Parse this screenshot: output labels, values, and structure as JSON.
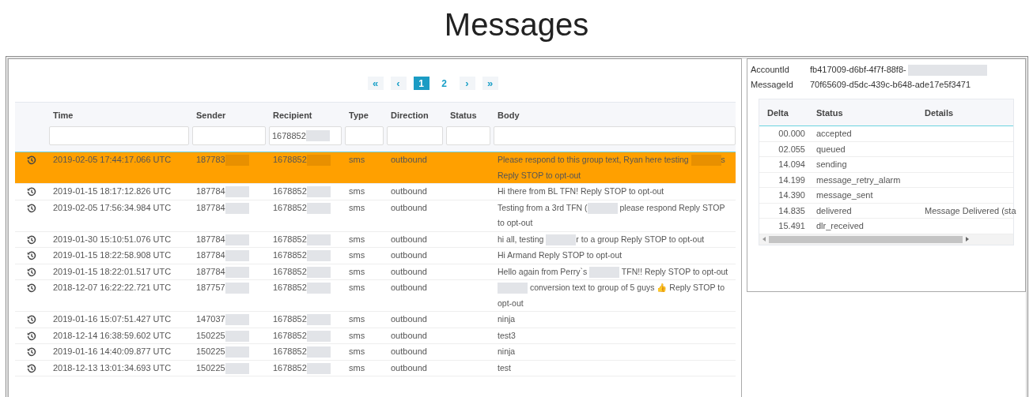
{
  "title": "Messages",
  "pagination": [
    {
      "label": "«",
      "kind": "first",
      "selected": false
    },
    {
      "label": "‹",
      "kind": "prev",
      "selected": false
    },
    {
      "label": "1",
      "kind": "page",
      "selected": true
    },
    {
      "label": "2",
      "kind": "page",
      "selected": false
    },
    {
      "label": "›",
      "kind": "next",
      "selected": false
    },
    {
      "label": "»",
      "kind": "last",
      "selected": false
    }
  ],
  "table": {
    "columns": [
      "Time",
      "Sender",
      "Recipient",
      "Type",
      "Direction",
      "Status",
      "Body"
    ],
    "filters": [
      {
        "redacted": false
      },
      {
        "redacted": false
      },
      {
        "value": "1678852",
        "redacted": true
      },
      {
        "redacted": false
      },
      {
        "redacted": false
      },
      {
        "redacted": false
      },
      {
        "redacted": false
      }
    ],
    "rows": [
      {
        "selected": true,
        "time": "2019-02-05 17:44:17.066 UTC",
        "sender": {
          "text": "187783",
          "redacted": true
        },
        "recipient": {
          "text": "1678852",
          "redacted": true
        },
        "type": "sms",
        "direction": "outbound",
        "body": [
          {
            "text": "Please respond to this group text, Ryan here testing "
          },
          {
            "kind": "redaction"
          },
          {
            "text": "s Reply STOP to opt-out"
          }
        ]
      },
      {
        "selected": false,
        "time": "2019-01-15 18:17:12.826 UTC",
        "sender": {
          "text": "187784",
          "redacted": true
        },
        "recipient": {
          "text": "1678852",
          "redacted": true
        },
        "type": "sms",
        "direction": "outbound",
        "body": [
          {
            "text": "Hi there from BL TFN! Reply STOP to opt-out"
          }
        ]
      },
      {
        "selected": false,
        "time": "2019-02-05 17:56:34.984 UTC",
        "sender": {
          "text": "187784",
          "redacted": true
        },
        "recipient": {
          "text": "1678852",
          "redacted": true
        },
        "type": "sms",
        "direction": "outbound",
        "body": [
          {
            "text": "Testing from a 3rd TFN ("
          },
          {
            "kind": "redaction"
          },
          {
            "text": " please respond Reply STOP to opt-out"
          }
        ]
      },
      {
        "selected": false,
        "time": "2019-01-30 15:10:51.076 UTC",
        "sender": {
          "text": "187784",
          "redacted": true
        },
        "recipient": {
          "text": "1678852",
          "redacted": true
        },
        "type": "sms",
        "direction": "outbound",
        "body": [
          {
            "text": "hi all, testing "
          },
          {
            "kind": "redaction"
          },
          {
            "text": "r to a group Reply STOP to opt-out"
          }
        ]
      },
      {
        "selected": false,
        "time": "2019-01-15 18:22:58.908 UTC",
        "sender": {
          "text": "187784",
          "redacted": true
        },
        "recipient": {
          "text": "1678852",
          "redacted": true
        },
        "type": "sms",
        "direction": "outbound",
        "body": [
          {
            "text": "Hi Armand Reply STOP to opt-out"
          }
        ]
      },
      {
        "selected": false,
        "time": "2019-01-15 18:22:01.517 UTC",
        "sender": {
          "text": "187784",
          "redacted": true
        },
        "recipient": {
          "text": "1678852",
          "redacted": true
        },
        "type": "sms",
        "direction": "outbound",
        "body": [
          {
            "text": "Hello again from Perry`s "
          },
          {
            "kind": "redaction"
          },
          {
            "text": " TFN!! Reply STOP to opt-out"
          }
        ]
      },
      {
        "selected": false,
        "time": "2018-12-07 16:22:22.721 UTC",
        "sender": {
          "text": "187757",
          "redacted": true
        },
        "recipient": {
          "text": "1678852",
          "redacted": true
        },
        "type": "sms",
        "direction": "outbound",
        "body": [
          {
            "kind": "redaction"
          },
          {
            "text": " conversion text to group of 5 guys 👍 Reply STOP to opt-out"
          }
        ]
      },
      {
        "selected": false,
        "time": "2019-01-16 15:07:51.427 UTC",
        "sender": {
          "text": "147037",
          "redacted": true
        },
        "recipient": {
          "text": "1678852",
          "redacted": true
        },
        "type": "sms",
        "direction": "outbound",
        "body": [
          {
            "text": "ninja"
          }
        ]
      },
      {
        "selected": false,
        "time": "2018-12-14 16:38:59.602 UTC",
        "sender": {
          "text": "150225",
          "redacted": true
        },
        "recipient": {
          "text": "1678852",
          "redacted": true
        },
        "type": "sms",
        "direction": "outbound",
        "body": [
          {
            "text": "test3"
          }
        ]
      },
      {
        "selected": false,
        "time": "2019-01-16 14:40:09.877 UTC",
        "sender": {
          "text": "150225",
          "redacted": true
        },
        "recipient": {
          "text": "1678852",
          "redacted": true
        },
        "type": "sms",
        "direction": "outbound",
        "body": [
          {
            "text": "ninja"
          }
        ]
      },
      {
        "selected": false,
        "time": "2018-12-13 13:01:34.693 UTC",
        "sender": {
          "text": "150225",
          "redacted": true
        },
        "recipient": {
          "text": "1678852",
          "redacted": true
        },
        "type": "sms",
        "direction": "outbound",
        "body": [
          {
            "text": "test"
          }
        ]
      }
    ]
  },
  "details": {
    "fields": [
      {
        "label": "AccountId",
        "value": "fb417009-d6bf-4f7f-88f8-",
        "redacted": true
      },
      {
        "label": "MessageId",
        "value": "70f65609-d5dc-439c-b648-ade17e5f3471",
        "redacted": false
      }
    ],
    "columns": [
      "Delta",
      "Status",
      "Details"
    ],
    "rows": [
      {
        "delta": "00.000",
        "status": "accepted"
      },
      {
        "delta": "02.055",
        "status": "queued"
      },
      {
        "delta": "14.094",
        "status": "sending"
      },
      {
        "delta": "14.199",
        "status": "message_retry_alarm"
      },
      {
        "delta": "14.390",
        "status": "message_sent"
      },
      {
        "delta": "14.835",
        "status": "delivered",
        "details": "Message Delivered (sta"
      },
      {
        "delta": "15.491",
        "status": "dlr_received"
      }
    ]
  }
}
